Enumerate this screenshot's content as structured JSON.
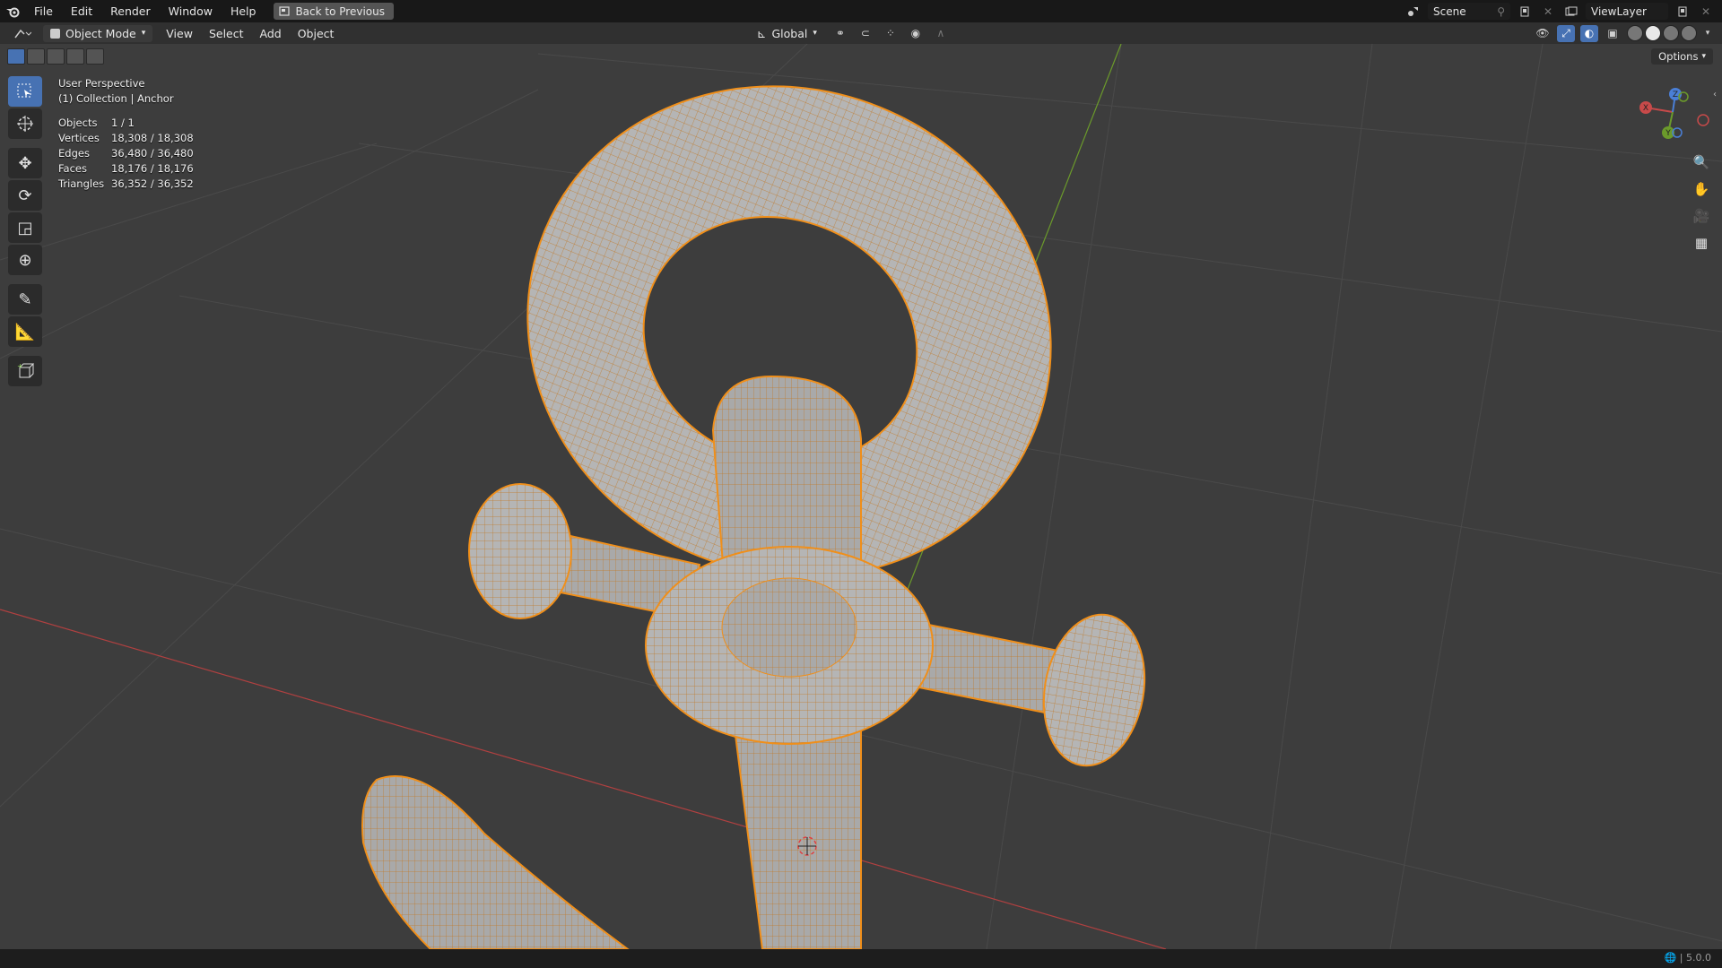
{
  "topbar": {
    "menu": [
      "File",
      "Edit",
      "Render",
      "Window",
      "Help"
    ],
    "back_button": "Back to Previous",
    "scene_name": "Scene",
    "view_layer_name": "ViewLayer"
  },
  "header": {
    "mode": "Object Mode",
    "menus": [
      "View",
      "Select",
      "Add",
      "Object"
    ],
    "transform_orientation": "Global",
    "options_label": "Options"
  },
  "viewport": {
    "view_name": "User Perspective",
    "collection_info": "(1) Collection | Anchor",
    "stats": [
      {
        "label": "Objects",
        "value": "1 / 1"
      },
      {
        "label": "Vertices",
        "value": "18,308 / 18,308"
      },
      {
        "label": "Edges",
        "value": "36,480 / 36,480"
      },
      {
        "label": "Faces",
        "value": "18,176 / 18,176"
      },
      {
        "label": "Triangles",
        "value": "36,352 / 36,352"
      }
    ],
    "gizmo_axes": [
      "X",
      "Y",
      "Z"
    ]
  },
  "status": {
    "version": "5.0.0"
  },
  "colors": {
    "accent": "#4772b3",
    "selection_outline": "#f08f1a",
    "x_axis": "#c84a4a",
    "y_axis": "#6b9a2b",
    "z_axis": "#4a7fd6"
  }
}
